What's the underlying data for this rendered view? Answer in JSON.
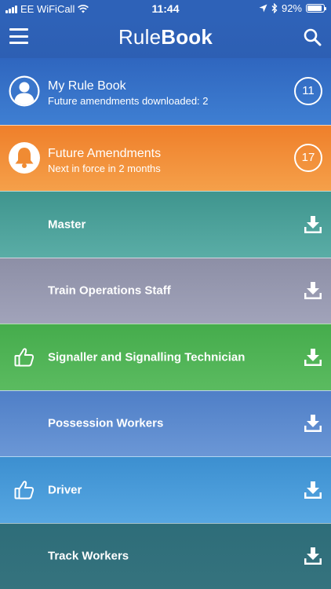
{
  "status_bar": {
    "carrier": "EE WiFiCall",
    "time": "11:44",
    "battery_percent": "92%",
    "battery_level": 0.92,
    "icons": [
      "signal-bars-icon",
      "wifi-icon",
      "location-arrow-icon",
      "bluetooth-icon",
      "battery-icon"
    ]
  },
  "header": {
    "brand_part1": "Rule",
    "brand_part2": "Book",
    "color": "#2e62b8"
  },
  "rows": [
    {
      "id": "my-rule-book",
      "title": "My Rule Book",
      "subtitle": "Future amendments downloaded: 2",
      "badge": "11",
      "icon": "person-icon",
      "color": "#2f66bf"
    },
    {
      "id": "future-amendments",
      "title": "Future Amendments",
      "subtitle": "Next in force in 2 months",
      "badge": "17",
      "icon": "bell-icon",
      "color": "#ef7f2a"
    },
    {
      "id": "master",
      "title": "Master",
      "icon": "download-icon",
      "color": "#3f958e"
    },
    {
      "id": "train-operations-staff",
      "title": "Train Operations Staff",
      "icon": "download-icon",
      "color": "#8d8fa6"
    },
    {
      "id": "signaller",
      "title": "Signaller and Signalling Technician",
      "icon": "download-icon",
      "lead_icon": "thumbs-up-icon",
      "color": "#45ac4c"
    },
    {
      "id": "possession-workers",
      "title": "Possession Workers",
      "icon": "download-icon",
      "color": "#4f7fc7"
    },
    {
      "id": "driver",
      "title": "Driver",
      "icon": "download-icon",
      "lead_icon": "thumbs-up-icon",
      "color": "#3c8fd0"
    },
    {
      "id": "track-workers",
      "title": "Track Workers",
      "icon": "download-icon",
      "color": "#2e6d79"
    }
  ]
}
